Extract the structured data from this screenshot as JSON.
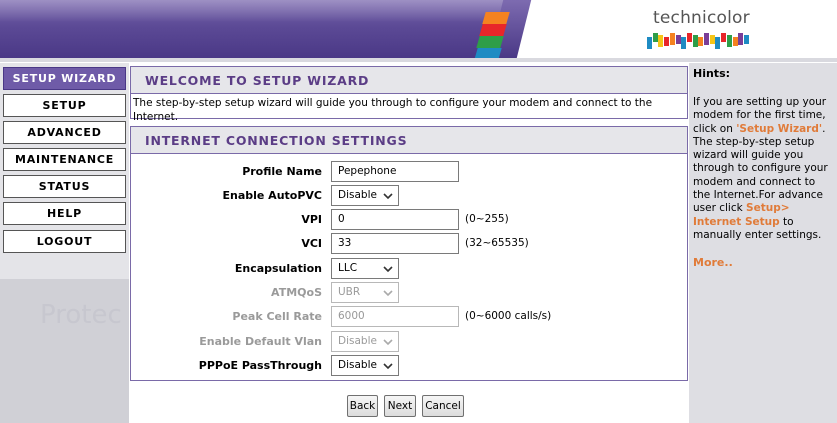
{
  "brand": {
    "name": "technicolor",
    "stripe_colors": [
      "#f58220",
      "#e8262a",
      "#2e9e48",
      "#1e8bc3"
    ],
    "logo_bar_colors": [
      "#1e8bc3",
      "#2e9e48",
      "#f5c518",
      "#e8262a",
      "#f58220",
      "#7a3d97",
      "#1e8bc3",
      "#e8262a",
      "#2e9e48",
      "#f58220",
      "#7a3d97",
      "#f5c518",
      "#1e8bc3",
      "#e8262a",
      "#2e9e48",
      "#f58220",
      "#7a3d97",
      "#1e8bc3"
    ]
  },
  "sidebar": {
    "items": [
      {
        "label": "SETUP WIZARD",
        "active": true
      },
      {
        "label": "SETUP",
        "active": false
      },
      {
        "label": "ADVANCED",
        "active": false
      },
      {
        "label": "MAINTENANCE",
        "active": false
      },
      {
        "label": "STATUS",
        "active": false
      },
      {
        "label": "HELP",
        "active": false
      },
      {
        "label": "LOGOUT",
        "active": false
      }
    ],
    "watermark": "Protec"
  },
  "welcome": {
    "title": "WELCOME TO SETUP WIZARD",
    "text": "The step-by-step setup wizard will guide you through to configure your modem and connect to the Internet."
  },
  "settings": {
    "title": "INTERNET CONNECTION SETTINGS",
    "profile_name": {
      "label": "Profile Name",
      "value": "Pepephone"
    },
    "auto_pvc": {
      "label": "Enable AutoPVC",
      "value": "Disable"
    },
    "vpi": {
      "label": "VPI",
      "value": "0",
      "range": "(0~255)"
    },
    "vci": {
      "label": "VCI",
      "value": "33",
      "range": "(32~65535)"
    },
    "encapsulation": {
      "label": "Encapsulation",
      "value": "LLC"
    },
    "atmqos": {
      "label": "ATMQoS",
      "value": "UBR"
    },
    "peak_cell_rate": {
      "label": "Peak Cell Rate",
      "value": "6000",
      "range": "(0~6000 calls/s)"
    },
    "default_vlan": {
      "label": "Enable Default Vlan",
      "value": "Disable"
    },
    "pppoe_passthrough": {
      "label": "PPPoE PassThrough",
      "value": "Disable"
    }
  },
  "buttons": {
    "back": "Back",
    "next": "Next",
    "cancel": "Cancel"
  },
  "hints": {
    "title": "Hints:",
    "p1": "If you are setting up your modem for the first time, click on ",
    "link1": "'Setup Wizard'",
    "p2": ". The step-by-step setup wizard will guide you through to configure your modem and connect to the Internet.For advance user click ",
    "link2": "Setup> Internet Setup",
    "p3": " to manually enter settings.",
    "more": "More.."
  }
}
